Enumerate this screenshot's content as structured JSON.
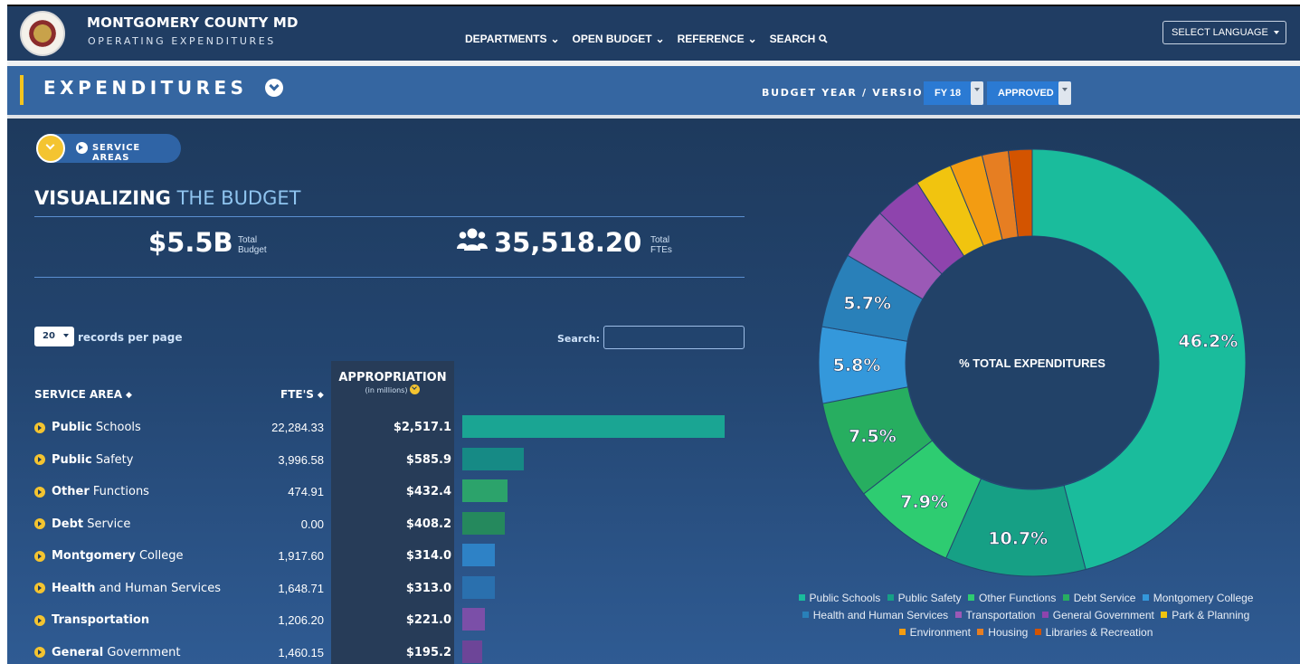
{
  "header": {
    "title": "MONTGOMERY COUNTY MD",
    "subtitle": "OPERATING EXPENDITURES",
    "nav": [
      "DEPARTMENTS",
      "OPEN BUDGET",
      "REFERENCE",
      "SEARCH"
    ],
    "language_select": "SELECT LANGUAGE"
  },
  "subheader": {
    "title": "EXPENDITURES",
    "budget_label": "BUDGET YEAR / VERSION:",
    "year": "FY 18",
    "version": "APPROVED"
  },
  "breadcrumb": {
    "label": "SERVICE AREAS"
  },
  "summary": {
    "title_bold": "VISUALIZING",
    "title_light": "THE BUDGET",
    "total_budget": "$5.5B",
    "total_budget_label_1": "Total",
    "total_budget_label_2": "Budget",
    "total_ftes": "35,518.20",
    "total_ftes_label_1": "Total",
    "total_ftes_label_2": "FTEs"
  },
  "table": {
    "records_value": "20",
    "records_label": "records per page",
    "search_label": "Search:",
    "search_value": "",
    "col_service_area": "SERVICE AREA",
    "col_ftes": "FTE'S",
    "col_appropriation": "APPROPRIATION",
    "col_appropriation_sub": "(in millions)",
    "rows": [
      {
        "bold": "Public",
        "rest": "Schools",
        "fte": "22,284.33",
        "amount": "$2,517.1",
        "value": 2517.1,
        "color": "#1aa593"
      },
      {
        "bold": "Public",
        "rest": "Safety",
        "fte": "3,996.58",
        "amount": "$585.9",
        "value": 585.9,
        "color": "#168a85"
      },
      {
        "bold": "Other",
        "rest": "Functions",
        "fte": "474.91",
        "amount": "$432.4",
        "value": 432.4,
        "color": "#2ca36b"
      },
      {
        "bold": "Debt",
        "rest": "Service",
        "fte": "0.00",
        "amount": "$408.2",
        "value": 408.2,
        "color": "#25895d"
      },
      {
        "bold": "Montgomery",
        "rest": "College",
        "fte": "1,917.60",
        "amount": "$314.0",
        "value": 314.0,
        "color": "#2e82c6"
      },
      {
        "bold": "Health",
        "rest": "and Human Services",
        "fte": "1,648.71",
        "amount": "$313.0",
        "value": 313.0,
        "color": "#2a70ae"
      },
      {
        "bold": "Transportation",
        "rest": "",
        "fte": "1,206.20",
        "amount": "$221.0",
        "value": 221.0,
        "color": "#7b4fa8"
      },
      {
        "bold": "General",
        "rest": "Government",
        "fte": "1,460.15",
        "amount": "$195.2",
        "value": 195.2,
        "color": "#6d4598"
      }
    ]
  },
  "chart_data": {
    "type": "pie",
    "center_label": "% TOTAL EXPENDITURES",
    "categories": [
      "Public Schools",
      "Public Safety",
      "Other Functions",
      "Debt Service",
      "Montgomery College",
      "Health and Human Services",
      "Transportation",
      "General Government",
      "Park & Planning",
      "Environment",
      "Housing",
      "Libraries & Recreation"
    ],
    "values": [
      46.2,
      10.7,
      7.9,
      7.5,
      5.8,
      5.7,
      4.0,
      3.6,
      2.8,
      2.5,
      2.0,
      1.8
    ],
    "labels": [
      "46.2%",
      "10.7%",
      "7.9%",
      "7.5%",
      "5.8%",
      "5.7%",
      "",
      "",
      "",
      "",
      "",
      ""
    ],
    "colors": [
      "#1abc9c",
      "#16a085",
      "#2ecc71",
      "#27ae60",
      "#3498db",
      "#2980b9",
      "#9b59b6",
      "#8e44ad",
      "#f1c40f",
      "#f39c12",
      "#e67e22",
      "#d35400"
    ],
    "legend": "bottom"
  }
}
